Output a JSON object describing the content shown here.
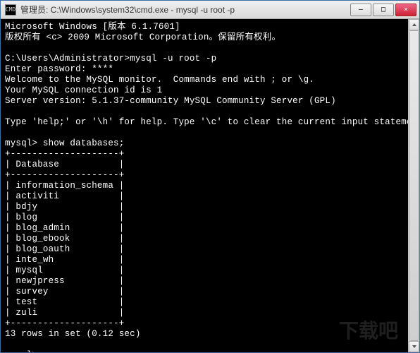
{
  "window": {
    "title": "管理员: C:\\Windows\\system32\\cmd.exe - mysql  -u root -p",
    "icon_label": "CMD"
  },
  "controls": {
    "minimize_glyph": "–",
    "maximize_glyph": "□",
    "close_glyph": "×"
  },
  "terminal": {
    "banner_line1": "Microsoft Windows [版本 6.1.7601]",
    "banner_line2": "版权所有 <c> 2009 Microsoft Corporation。保留所有权利。",
    "blank": "",
    "prompt1": "C:\\Users\\Administrator>mysql -u root -p",
    "password_line": "Enter password: ****",
    "welcome_line1": "Welcome to the MySQL monitor.  Commands end with ; or \\g.",
    "welcome_line2": "Your MySQL connection id is 1",
    "welcome_line3": "Server version: 5.1.37-community MySQL Community Server (GPL)",
    "help_line": "Type 'help;' or '\\h' for help. Type '\\c' to clear the current input statement.",
    "query_prompt": "mysql> show databases;",
    "table_border": "+--------------------+",
    "table_header": "| Database           |",
    "rows": [
      "| information_schema |",
      "| activiti           |",
      "| bdjy               |",
      "| blog               |",
      "| blog_admin         |",
      "| blog_ebook         |",
      "| blog_oauth         |",
      "| inte_wh            |",
      "| mysql              |",
      "| newjpress          |",
      "| survey             |",
      "| test               |",
      "| zuli               |"
    ],
    "result_summary": "13 rows in set (0.12 sec)",
    "final_prompt": "mysql> "
  },
  "watermark": "下载吧"
}
